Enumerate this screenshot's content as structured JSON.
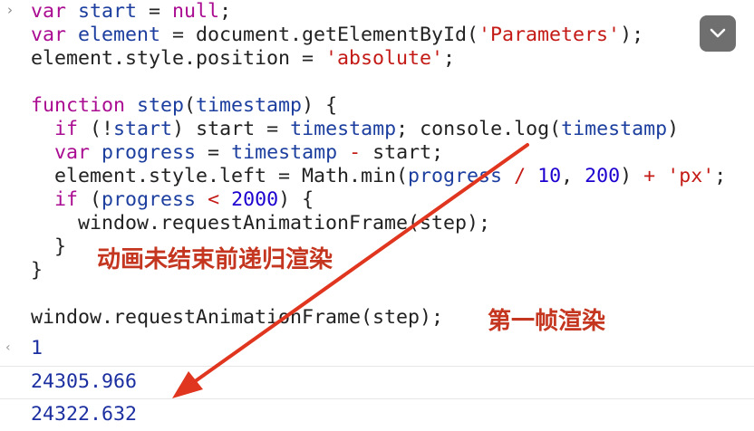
{
  "console": {
    "prompt_glyph": "›",
    "result_glyph": "‹",
    "code": [
      [
        [
          "kw",
          "var "
        ],
        [
          "ident",
          "start"
        ],
        [
          "plain",
          " = "
        ],
        [
          "kw",
          "null"
        ],
        [
          "plain",
          ";"
        ]
      ],
      [
        [
          "kw",
          "var "
        ],
        [
          "ident",
          "element"
        ],
        [
          "plain",
          " = document.getElementById("
        ],
        [
          "str",
          "'Parameters'"
        ],
        [
          "plain",
          ");"
        ]
      ],
      [
        [
          "plain",
          "element.style.position = "
        ],
        [
          "str",
          "'absolute'"
        ],
        [
          "plain",
          ";"
        ]
      ],
      [],
      [
        [
          "kw",
          "function "
        ],
        [
          "ident",
          "step"
        ],
        [
          "plain",
          "("
        ],
        [
          "ident",
          "timestamp"
        ],
        [
          "plain",
          ") {"
        ]
      ],
      [
        [
          "plain",
          "  "
        ],
        [
          "kw",
          "if"
        ],
        [
          "plain",
          " (!"
        ],
        [
          "ident",
          "start"
        ],
        [
          "plain",
          ") start = "
        ],
        [
          "ident",
          "timestamp"
        ],
        [
          "plain",
          "; console.log("
        ],
        [
          "ident",
          "timestamp"
        ],
        [
          "plain",
          ")"
        ]
      ],
      [
        [
          "plain",
          "  "
        ],
        [
          "kw",
          "var "
        ],
        [
          "ident",
          "progress"
        ],
        [
          "plain",
          " = "
        ],
        [
          "ident",
          "timestamp"
        ],
        [
          "plain",
          " "
        ],
        [
          "str",
          "-"
        ],
        [
          "plain",
          " start;"
        ]
      ],
      [
        [
          "plain",
          "  element.style.left = Math.min("
        ],
        [
          "ident",
          "progress"
        ],
        [
          "plain",
          " "
        ],
        [
          "str",
          "/"
        ],
        [
          "plain",
          " "
        ],
        [
          "num",
          "10"
        ],
        [
          "plain",
          ", "
        ],
        [
          "num",
          "200"
        ],
        [
          "plain",
          ") "
        ],
        [
          "str",
          "+"
        ],
        [
          "plain",
          " "
        ],
        [
          "str",
          "'px'"
        ],
        [
          "plain",
          ";"
        ]
      ],
      [
        [
          "plain",
          "  "
        ],
        [
          "kw",
          "if"
        ],
        [
          "plain",
          " ("
        ],
        [
          "ident",
          "progress"
        ],
        [
          "plain",
          " "
        ],
        [
          "str",
          "<"
        ],
        [
          "plain",
          " "
        ],
        [
          "num",
          "2000"
        ],
        [
          "plain",
          ") {"
        ]
      ],
      [
        [
          "plain",
          "    window.requestAnimationFrame(step);"
        ]
      ],
      [
        [
          "plain",
          "  }"
        ]
      ],
      [
        [
          "plain",
          "}"
        ]
      ],
      [],
      [
        [
          "plain",
          "window.requestAnimationFrame(step);"
        ]
      ]
    ],
    "outputs": [
      "1",
      "24305.966",
      "24322.632"
    ]
  },
  "annotations": {
    "recursive_render": "动画未结束前递归渲染",
    "first_frame": "第一帧渲染"
  },
  "colors": {
    "annotation": "#c4361f",
    "keyword": "#aa0d91",
    "identifier": "#1c3e9e",
    "string": "#c41a16",
    "number": "#1c00cf",
    "output": "#1c2fa0"
  },
  "icons": {
    "expand": "chevron-down-icon"
  }
}
